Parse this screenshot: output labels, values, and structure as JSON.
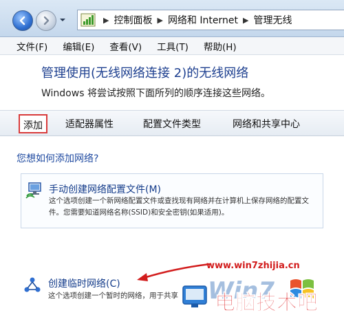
{
  "address_bar": {
    "breadcrumbs": [
      "控制面板",
      "网络和 Internet",
      "管理无线"
    ]
  },
  "menu": {
    "items": [
      "文件(F)",
      "编辑(E)",
      "查看(V)",
      "工具(T)",
      "帮助(H)"
    ]
  },
  "header": {
    "title": "管理使用(无线网络连接 2)的无线网络",
    "description": "Windows 将尝试按照下面所列的顺序连接这些网络。"
  },
  "toolbar": {
    "add": "添加",
    "adapter_properties": "适配器属性",
    "profile_types": "配置文件类型",
    "sharing_center": "网络和共享中心"
  },
  "main": {
    "question": "您想如何添加网络?",
    "options": [
      {
        "title": "手动创建网络配置文件(M)",
        "desc_line1": "这个选项创建一个新网络配置文件或查找现有网络并在计算机上保存网络的配置文",
        "desc_line2": "件。您需要知道网络名称(SSID)和安全密钥(如果适用)。",
        "icon": "network-monitor-icon"
      },
      {
        "title": "创建临时网络(C)",
        "desc": "这个选项创建一个暂时的网络，用于共享",
        "icon": "adhoc-network-icon"
      }
    ]
  },
  "watermark": {
    "url": "www.win7zhijia.cn",
    "logo_text": "Win7",
    "site_name": "电脑技术吧"
  },
  "colors": {
    "title_blue": "#1d3f8f",
    "link_blue": "#1f4aa0",
    "highlight_red": "#d93a3a"
  }
}
